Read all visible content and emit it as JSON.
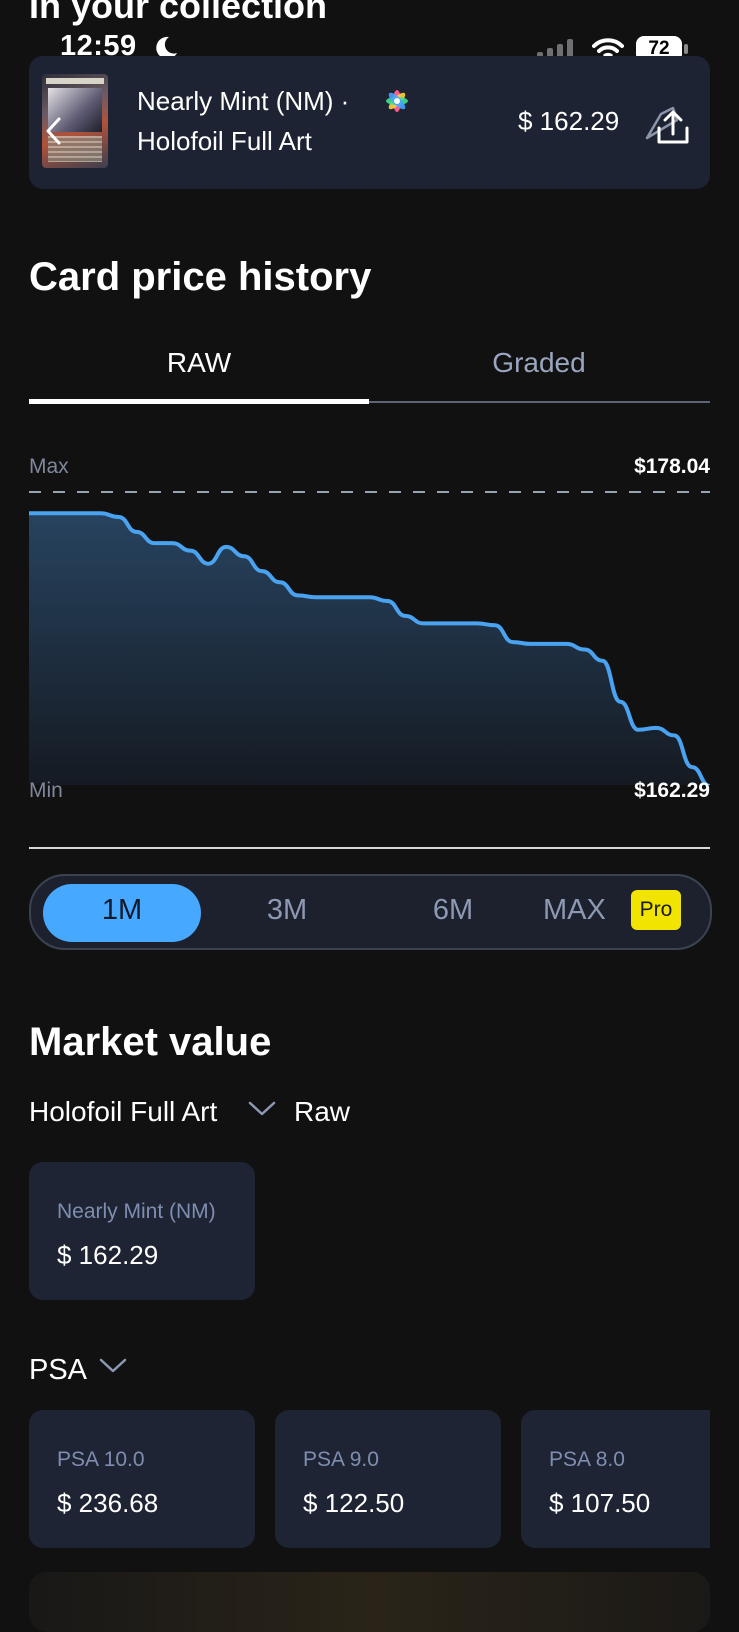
{
  "header": {
    "peek_title": "In your collection"
  },
  "status_bar": {
    "time": "12:59",
    "battery": "72"
  },
  "collection_card": {
    "condition": "Nearly Mint (NM) ·",
    "variant": "Holofoil Full Art",
    "price": "$ 162.29",
    "icons": [
      "back-chevron-icon",
      "holofoil-icon",
      "share-icon"
    ]
  },
  "price_history": {
    "title": "Card price history",
    "tabs": [
      {
        "label": "RAW",
        "active": true
      },
      {
        "label": "Graded",
        "active": false
      }
    ],
    "max_label": "Max",
    "max_value": "$178.04",
    "min_label": "Min",
    "min_value": "$162.29",
    "ranges": [
      {
        "label": "1M",
        "active": true
      },
      {
        "label": "3M",
        "active": false
      },
      {
        "label": "6M",
        "active": false
      },
      {
        "label": "MAX",
        "active": false
      }
    ],
    "pro_badge": "Pro"
  },
  "chart_data": {
    "type": "area",
    "y_range": [
      162.29,
      178.04
    ],
    "values": [
      176.9,
      176.9,
      176.9,
      176.9,
      176.9,
      176.7,
      175.9,
      175.3,
      175.3,
      174.9,
      174.2,
      175.1,
      174.6,
      173.8,
      173.2,
      172.5,
      172.4,
      172.4,
      172.4,
      172.4,
      172.2,
      171.4,
      171.0,
      171.0,
      171.0,
      171.0,
      170.9,
      170.0,
      169.9,
      169.9,
      169.9,
      169.6,
      169.0,
      166.8,
      165.3,
      165.4,
      165.0,
      163.3,
      162.29
    ],
    "color": "#4aa3f0",
    "grid": false
  },
  "market_value": {
    "title": "Market value",
    "variant": "Holofoil Full Art",
    "type": "Raw",
    "nm_card": {
      "label": "Nearly Mint (NM)",
      "value": "$ 162.29"
    },
    "grading_company": "PSA",
    "psa_cards": [
      {
        "label": "PSA 10.0",
        "value": "$ 236.68"
      },
      {
        "label": "PSA 9.0",
        "value": "$ 122.50"
      },
      {
        "label": "PSA 8.0",
        "value": "$ 107.50"
      }
    ]
  },
  "colors": {
    "background": "#111112",
    "card": "#1d2332",
    "accent": "#47a8ff",
    "pro": "#f1e400",
    "muted_text": "#8d99b3"
  }
}
